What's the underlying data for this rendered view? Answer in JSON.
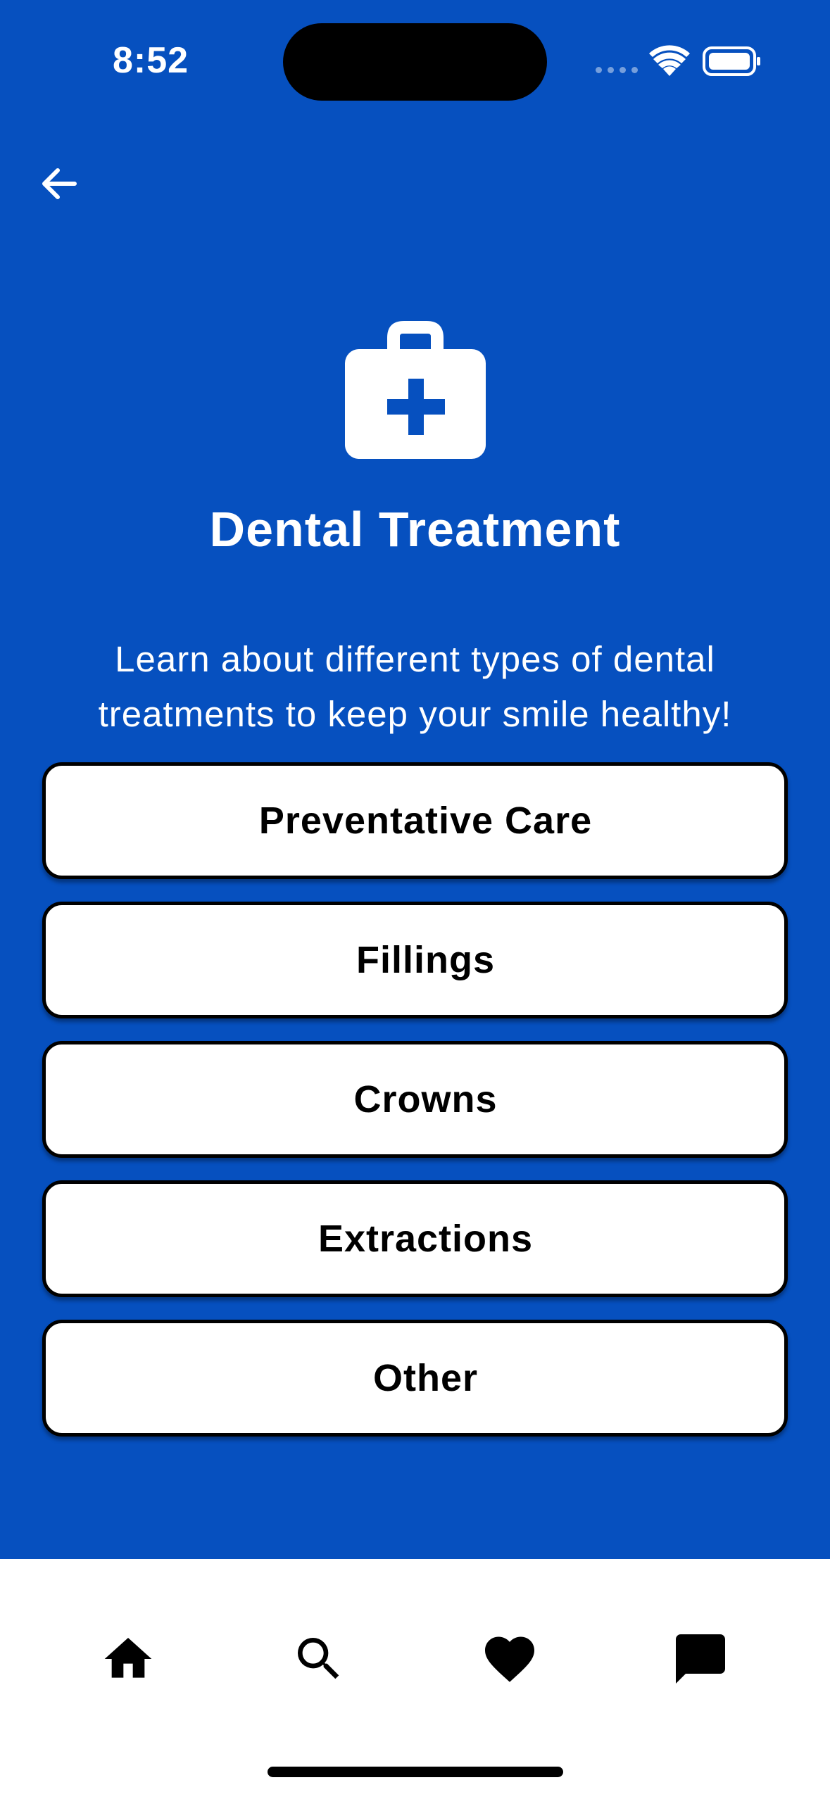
{
  "status_bar": {
    "time": "8:52"
  },
  "header": {
    "back_icon": "arrow-left-icon"
  },
  "hero": {
    "icon": "medical-kit-icon",
    "title": "Dental Treatment",
    "description": "Learn about different types of dental treatments to keep your smile healthy!"
  },
  "options": [
    {
      "label": "Preventative Care"
    },
    {
      "label": "Fillings"
    },
    {
      "label": "Crowns"
    },
    {
      "label": "Extractions"
    },
    {
      "label": "Other"
    }
  ],
  "bottom_nav": {
    "items": [
      {
        "icon": "home-icon"
      },
      {
        "icon": "search-icon"
      },
      {
        "icon": "heart-icon"
      },
      {
        "icon": "chat-icon"
      }
    ]
  },
  "colors": {
    "primary_blue": "#0650bf",
    "button_bg": "#ffffff",
    "button_border": "#000000",
    "nav_bg": "#ffffff"
  }
}
